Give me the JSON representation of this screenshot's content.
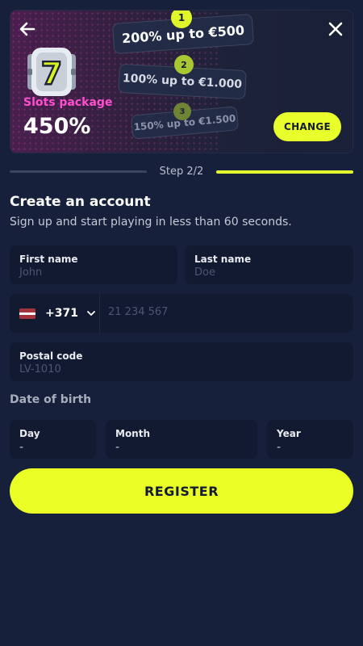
{
  "promo": {
    "package_label": "Slots package",
    "package_value": "450%",
    "tiers": [
      {
        "number": "1",
        "text": "200% up to €500"
      },
      {
        "number": "2",
        "text": "100% up to €1.000"
      },
      {
        "number": "3",
        "text": "150% up to €1.500"
      }
    ],
    "change_label": "CHANGE",
    "slot_symbol": "7",
    "icons": {
      "back": "arrow-left-icon",
      "close": "close-icon",
      "slot": "slot-machine-icon"
    }
  },
  "step": {
    "label": "Step 2/2",
    "progress": 1.0
  },
  "header": {
    "title": "Create an account",
    "subtitle": "Sign up and start playing in less than 60 seconds."
  },
  "form": {
    "first_name": {
      "label": "First name",
      "placeholder": "John"
    },
    "last_name": {
      "label": "Last name",
      "placeholder": "Doe"
    },
    "phone": {
      "country_flag": "Latvia",
      "dial_code": "+371",
      "placeholder": "21 234 567"
    },
    "postal_code": {
      "label": "Postal code",
      "placeholder": "LV-1010"
    },
    "dob": {
      "label": "Date of birth",
      "day": {
        "label": "Day",
        "value": "-"
      },
      "month": {
        "label": "Month",
        "value": "-"
      },
      "year": {
        "label": "Year",
        "value": "-"
      }
    },
    "register_label": "REGISTER"
  },
  "colors": {
    "background": "#16203a",
    "accent": "#e9ff26",
    "package_label": "#ff4fd0",
    "field_background": "#111a30"
  }
}
